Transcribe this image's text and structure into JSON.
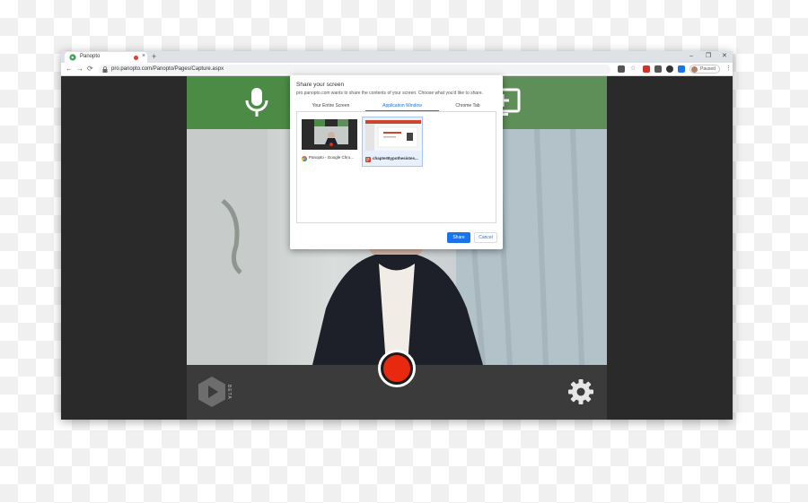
{
  "browser": {
    "tab_title": "Panopto",
    "tab_close": "×",
    "new_tab": "+",
    "url": "pro.panopto.com/Panopto/Pages/Capture.aspx",
    "back": "←",
    "forward": "→",
    "reload": "⟳",
    "profile_label": "Paused",
    "menu": "⋮",
    "window_controls": {
      "minimize": "–",
      "maximize": "❐",
      "close": "✕"
    },
    "accent_color": "#1a73e8"
  },
  "app": {
    "mic_icon": "microphone-icon",
    "add_screen_icon": "add-screen-icon",
    "record_color": "#e8280f",
    "beta_label": "BETA",
    "settings_icon": "gear-icon",
    "green": "#4b8b45"
  },
  "share_dialog": {
    "title": "Share your screen",
    "description": "pro.panopto.com wants to share the contents of your screen. Choose what you'd like to share.",
    "tabs": [
      "Your Entire Screen",
      "Application Window",
      "Chrome Tab"
    ],
    "active_tab": "Application Window",
    "sources": [
      {
        "label": "Panopto - Google Chro...",
        "selected": false
      },
      {
        "label": "chapterBypothesistes...",
        "selected": true
      }
    ],
    "share_label": "Share",
    "cancel_label": "Cancel"
  }
}
